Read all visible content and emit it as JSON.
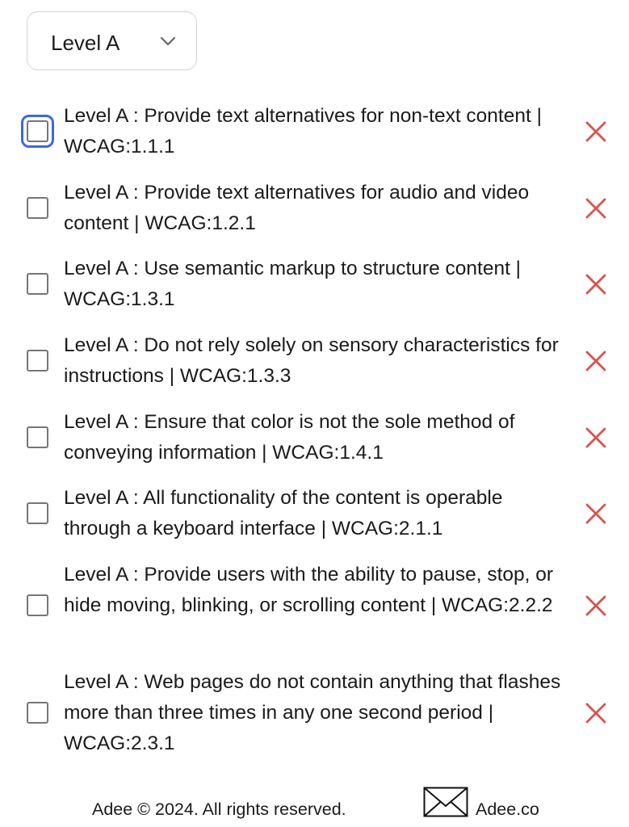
{
  "filter": {
    "selected": "Level A"
  },
  "checklist": {
    "items": [
      {
        "text": "Level A : Provide text alternatives for non-text content | WCAG:1.1.1",
        "checked": false
      },
      {
        "text": "Level A : Provide text alternatives for audio and video content | WCAG:1.2.1",
        "checked": false
      },
      {
        "text": "Level A : Use semantic markup to structure content | WCAG:1.3.1",
        "checked": false
      },
      {
        "text": "Level A : Do not rely solely on sensory characteristics for instructions | WCAG:1.3.3",
        "checked": false
      },
      {
        "text": "Level A : Ensure that color is not the sole method of conveying information | WCAG:1.4.1",
        "checked": false
      },
      {
        "text": "Level A : All functionality of the content is operable through a keyboard interface | WCAG:2.1.1",
        "checked": false
      },
      {
        "text": "Level A : Provide users with the ability to pause, stop, or hide moving, blinking, or scrolling content | WCAG:2.2.2",
        "checked": false
      },
      {
        "text": "Level A : Web pages do not contain anything that flashes more than three times in any one second period | WCAG:2.3.1",
        "checked": false
      }
    ]
  },
  "footer": {
    "copyright": "Adee © 2024. All rights reserved.",
    "link_label": "Adee.co"
  },
  "colors": {
    "focus": "#3b67e3",
    "remove": "#d9534f",
    "border": "#d3d3d3"
  },
  "icons": {
    "select": "chevron-down-icon",
    "remove": "close-icon",
    "footer_link": "envelope-icon"
  }
}
